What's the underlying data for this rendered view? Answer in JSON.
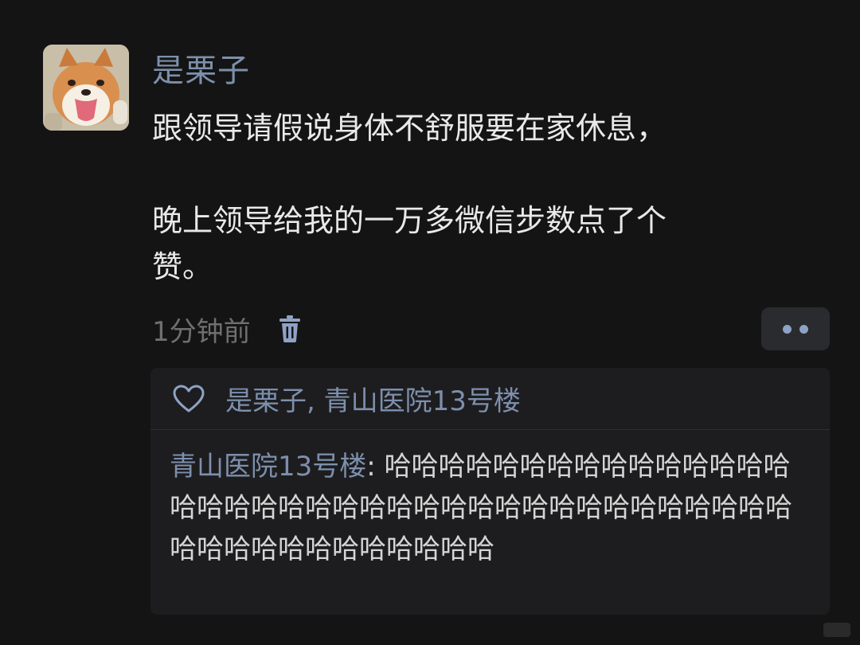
{
  "post": {
    "author": "是栗子",
    "content_line1": "跟领导请假说身体不舒服要在家休息，",
    "content_line2": "晚上领导给我的一万多微信步数点了个",
    "content_line3": "赞。",
    "time": "1分钟前"
  },
  "icons": {
    "avatar": "shiba-dog-avatar",
    "delete": "trash-icon",
    "more": "more-dots-icon",
    "like": "heart-icon"
  },
  "interactions": {
    "likers": "是栗子, 青山医院13号楼",
    "comment_author": "青山医院13号楼",
    "comment_separator": ": ",
    "comment_text": "哈哈哈哈哈哈哈哈哈哈哈哈哈哈哈哈哈哈哈哈哈哈哈哈哈哈哈哈哈哈哈哈哈哈哈哈哈哈哈哈哈哈哈哈哈哈哈哈哈哈"
  },
  "colors": {
    "background": "#141414",
    "author_link": "#7d8fac",
    "panel": "#1d1d1f"
  }
}
